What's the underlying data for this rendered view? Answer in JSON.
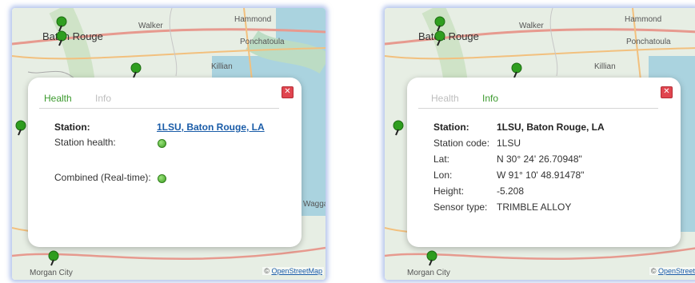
{
  "map": {
    "places": {
      "baton_rouge": "Baton Rouge",
      "walker": "Walker",
      "hammond": "Hammond",
      "ponchatoula": "Ponchatoula",
      "killian": "Killian",
      "waggaman": "Wagga",
      "morgan_city": "Morgan City"
    },
    "attribution_prefix": "©",
    "attribution_left": "OpenStreetMap",
    "attribution_right": "OpenStreet"
  },
  "left_popup": {
    "tabs": [
      "Health",
      "Info"
    ],
    "active_tab": "Health",
    "station_label": "Station:",
    "station_value": "1LSU, Baton Rouge, LA",
    "health_label": "Station health:",
    "combined_label": "Combined (Real-time):",
    "status_color": "#4caf3a"
  },
  "right_popup": {
    "tabs": [
      "Health",
      "Info"
    ],
    "active_tab": "Info",
    "fields": [
      {
        "label": "Station:",
        "value": "1LSU, Baton Rouge, LA"
      },
      {
        "label": "Station code:",
        "value": "1LSU"
      },
      {
        "label": "Lat:",
        "value": "N 30° 24' 26.70948\""
      },
      {
        "label": "Lon:",
        "value": "W 91° 10' 48.91478\""
      },
      {
        "label": "Height:",
        "value": "-5.208"
      },
      {
        "label": "Sensor type:",
        "value": "TRIMBLE ALLOY"
      }
    ]
  },
  "colors": {
    "accent": "#3c9a2e",
    "link": "#1a5ca8",
    "close": "#e0454f"
  }
}
